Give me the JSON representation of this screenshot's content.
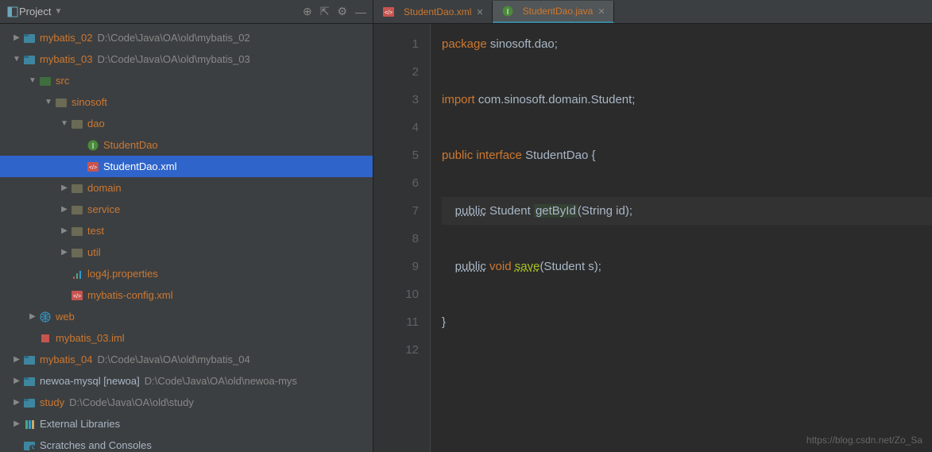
{
  "toolbar": {
    "title": "Project",
    "icons": {
      "target": "⊕",
      "collapse": "⇱",
      "gear": "⚙",
      "min": "—"
    }
  },
  "tree": [
    {
      "d": 0,
      "e": "r",
      "i": "mod",
      "t": "mybatis_02",
      "p": "D:\\Code\\Java\\OA\\old\\mybatis_02",
      "cls": "lbl"
    },
    {
      "d": 0,
      "e": "d",
      "i": "mod",
      "t": "mybatis_03",
      "p": "D:\\Code\\Java\\OA\\old\\mybatis_03",
      "cls": "lbl"
    },
    {
      "d": 1,
      "e": "d",
      "i": "src",
      "t": "src",
      "cls": "lbl"
    },
    {
      "d": 2,
      "e": "d",
      "i": "pkg",
      "t": "sinosoft",
      "cls": "lbl"
    },
    {
      "d": 3,
      "e": "d",
      "i": "pkg",
      "t": "dao",
      "cls": "lbl"
    },
    {
      "d": 4,
      "e": "",
      "i": "intf",
      "t": "StudentDao",
      "cls": "lbl"
    },
    {
      "d": 4,
      "e": "",
      "i": "xml",
      "t": "StudentDao.xml",
      "cls": "lbl sel",
      "sel": true
    },
    {
      "d": 3,
      "e": "r",
      "i": "pkg",
      "t": "domain",
      "cls": "lbl"
    },
    {
      "d": 3,
      "e": "r",
      "i": "pkg",
      "t": "service",
      "cls": "lbl"
    },
    {
      "d": 3,
      "e": "r",
      "i": "pkg",
      "t": "test",
      "cls": "lbl"
    },
    {
      "d": 3,
      "e": "r",
      "i": "pkg",
      "t": "util",
      "cls": "lbl"
    },
    {
      "d": 3,
      "e": "",
      "i": "prop",
      "t": "log4j.properties",
      "cls": "lbl"
    },
    {
      "d": 3,
      "e": "",
      "i": "xml",
      "t": "mybatis-config.xml",
      "cls": "lbl"
    },
    {
      "d": 1,
      "e": "r",
      "i": "web",
      "t": "web",
      "cls": "lbl"
    },
    {
      "d": 1,
      "e": "",
      "i": "iml",
      "t": "mybatis_03.iml",
      "cls": "lbl"
    },
    {
      "d": 0,
      "e": "r",
      "i": "mod",
      "t": "mybatis_04",
      "p": "D:\\Code\\Java\\OA\\old\\mybatis_04",
      "cls": "lbl"
    },
    {
      "d": 0,
      "e": "r",
      "i": "mod",
      "t": "newoa-mysql [newoa]",
      "p": "D:\\Code\\Java\\OA\\old\\newoa-mys",
      "cls": "lbl grey"
    },
    {
      "d": 0,
      "e": "r",
      "i": "mod",
      "t": "study",
      "p": "D:\\Code\\Java\\OA\\old\\study",
      "cls": "lbl"
    },
    {
      "d": 0,
      "e": "r",
      "i": "lib",
      "t": "External Libraries",
      "cls": "lbl grey"
    },
    {
      "d": 0,
      "e": "",
      "i": "scratch",
      "t": "Scratches and Consoles",
      "cls": "lbl grey"
    }
  ],
  "tabs": [
    {
      "label": "StudentDao.xml",
      "icon": "xml",
      "active": false
    },
    {
      "label": "StudentDao.java",
      "icon": "intf",
      "active": true
    }
  ],
  "code": {
    "lines": [
      {
        "n": 1,
        "h": [
          [
            "kw",
            "package"
          ],
          [
            "sp",
            " "
          ],
          [
            "pkg",
            "sinosoft.dao;"
          ]
        ]
      },
      {
        "n": 2,
        "h": []
      },
      {
        "n": 3,
        "h": [
          [
            "kw",
            "import"
          ],
          [
            "sp",
            " "
          ],
          [
            "pkg",
            "com.sinosoft.domain.Student;"
          ]
        ]
      },
      {
        "n": 4,
        "h": []
      },
      {
        "n": 5,
        "h": [
          [
            "kw",
            "public interface"
          ],
          [
            "sp",
            " "
          ],
          [
            "pkg",
            "StudentDao {"
          ]
        ]
      },
      {
        "n": 6,
        "h": []
      },
      {
        "n": 7,
        "hl": true,
        "h": [
          [
            "sp",
            "    "
          ],
          [
            "mu",
            "public"
          ],
          [
            "sp",
            " "
          ],
          [
            "pkg",
            "Student "
          ],
          [
            "hl",
            "getById"
          ],
          [
            "pkg",
            "(String id);"
          ]
        ]
      },
      {
        "n": 8,
        "h": []
      },
      {
        "n": 9,
        "h": [
          [
            "sp",
            "    "
          ],
          [
            "mu",
            "public"
          ],
          [
            "sp",
            " "
          ],
          [
            "kw",
            "void"
          ],
          [
            "sp",
            " "
          ],
          [
            "method",
            "save"
          ],
          [
            "pkg",
            "(Student s);"
          ]
        ]
      },
      {
        "n": 10,
        "h": []
      },
      {
        "n": 11,
        "h": [
          [
            "pkg",
            "}"
          ]
        ]
      },
      {
        "n": 12,
        "h": []
      }
    ]
  },
  "watermark": "https://blog.csdn.net/Zo_Sa"
}
